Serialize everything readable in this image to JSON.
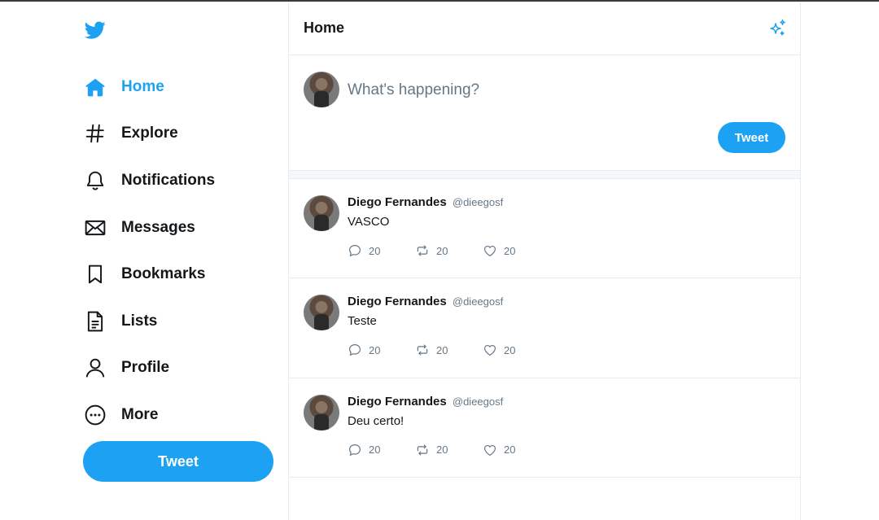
{
  "sidebar": {
    "logo_icon": "twitter-bird-icon",
    "items": [
      {
        "label": "Home",
        "icon": "home-icon",
        "active": true
      },
      {
        "label": "Explore",
        "icon": "hashtag-icon"
      },
      {
        "label": "Notifications",
        "icon": "bell-icon"
      },
      {
        "label": "Messages",
        "icon": "envelope-icon"
      },
      {
        "label": "Bookmarks",
        "icon": "bookmark-icon"
      },
      {
        "label": "Lists",
        "icon": "list-document-icon"
      },
      {
        "label": "Profile",
        "icon": "person-icon"
      },
      {
        "label": "More",
        "icon": "more-dots-icon"
      }
    ],
    "tweet_button": "Tweet"
  },
  "header": {
    "title": "Home",
    "icon": "sparkle-icon"
  },
  "composer": {
    "placeholder": "What's happening?",
    "tweet_button": "Tweet"
  },
  "feed": [
    {
      "name": "Diego Fernandes",
      "handle": "@dieegosf",
      "text": "VASCO",
      "replies": "20",
      "retweets": "20",
      "likes": "20"
    },
    {
      "name": "Diego Fernandes",
      "handle": "@dieegosf",
      "text": "Teste",
      "replies": "20",
      "retweets": "20",
      "likes": "20"
    },
    {
      "name": "Diego Fernandes",
      "handle": "@dieegosf",
      "text": "Deu certo!",
      "replies": "20",
      "retweets": "20",
      "likes": "20"
    }
  ],
  "colors": {
    "accent": "#1da1f2",
    "text": "#14171a",
    "muted": "#657786",
    "border": "#e6ecf0"
  }
}
